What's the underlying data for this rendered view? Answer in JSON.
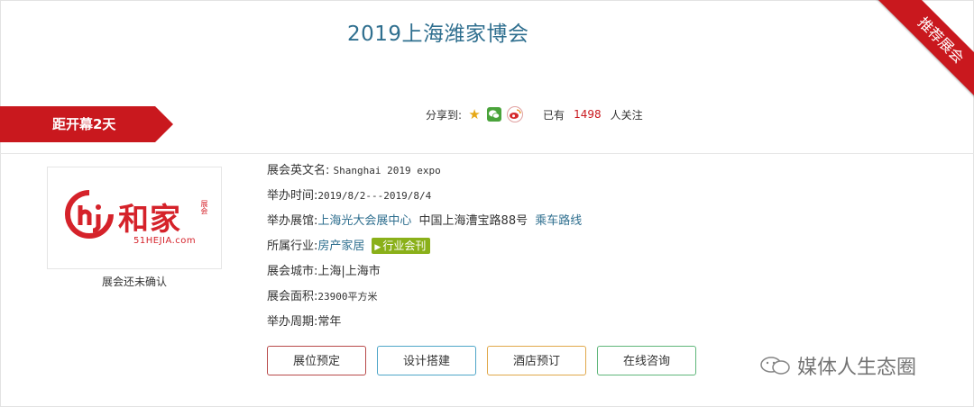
{
  "header": {
    "title": "2019上海潍家博会",
    "ribbon_label": "推荐展会",
    "countdown_label": "距开幕2天"
  },
  "share": {
    "label": "分享到:",
    "followers_prefix": "已有",
    "followers_count": "1498",
    "followers_suffix": "人关注",
    "icons": [
      "star-icon",
      "wechat-icon",
      "weibo-icon"
    ]
  },
  "logo": {
    "brand_text": "和家",
    "small_text": "展会",
    "url_text": "51HEJIA.com",
    "caption": "展会还未确认"
  },
  "details": {
    "english_name_label": "展会英文名:",
    "english_name_value": "Shanghai 2019 expo",
    "date_label": "举办时间:",
    "date_value": "2019/8/2---2019/8/4",
    "venue_label": "举办展馆:",
    "venue_name": "上海光大会展中心",
    "venue_address": "中国上海漕宝路88号",
    "venue_route": "乘车路线",
    "industry_label": "所属行业:",
    "industry_value": "房产家居",
    "industry_tag": "行业会刊",
    "city_label": "展会城市:",
    "city_value": "上海|上海市",
    "area_label": "展会面积:",
    "area_value": "23900平方米",
    "cycle_label": "举办周期:",
    "cycle_value": "常年"
  },
  "buttons": {
    "booth": "展位预定",
    "design": "设计搭建",
    "hotel": "酒店预订",
    "consult": "在线咨询"
  },
  "colors": {
    "accent_red": "#c9181e",
    "title_blue": "#2f6f8f",
    "tag_green": "#8ab019",
    "btn_booth_border": "#b84a4a",
    "btn_design_border": "#4ea6c8",
    "btn_hotel_border": "#e0a84a",
    "btn_consult_border": "#5fb67a"
  },
  "watermark": {
    "text": "媒体人生态圈"
  }
}
